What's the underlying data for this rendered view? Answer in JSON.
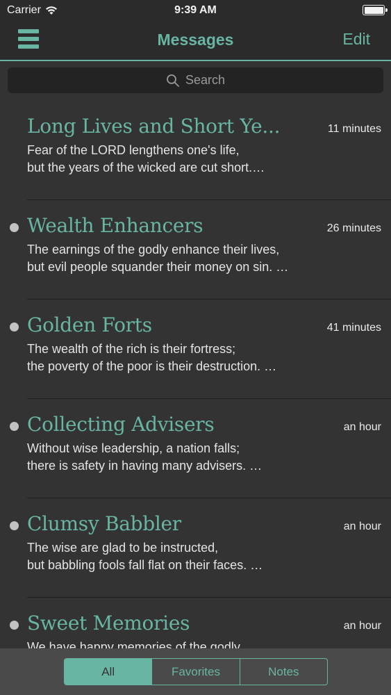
{
  "status_bar": {
    "carrier": "Carrier",
    "time": "9:39 AM"
  },
  "nav": {
    "title": "Messages",
    "edit_label": "Edit"
  },
  "search": {
    "placeholder": "Search"
  },
  "messages": [
    {
      "title": "Long Lives and Short Ye...",
      "time": "11 minutes",
      "unread": false,
      "line1": " Fear of the LORD lengthens one's life,",
      "line2": "but the years of the wicked are cut short.…"
    },
    {
      "title": "Wealth Enhancers",
      "time": "26 minutes",
      "unread": true,
      "line1": " The earnings of the godly enhance their lives,",
      "line2": "but evil people squander their money on sin. …"
    },
    {
      "title": "Golden Forts",
      "time": "41 minutes",
      "unread": true,
      "line1": " The wealth of the rich is their fortress;",
      "line2": "the poverty of the poor is their destruction. …"
    },
    {
      "title": "Collecting Advisers",
      "time": "an hour",
      "unread": true,
      "line1": " Without wise leadership, a nation falls;",
      "line2": "there is safety in having many advisers. …"
    },
    {
      "title": "Clumsy Babbler",
      "time": "an hour",
      "unread": true,
      "line1": " The wise are glad to be instructed,",
      "line2": "but babbling fools fall flat on their faces. …"
    },
    {
      "title": "Sweet Memories",
      "time": "an hour",
      "unread": true,
      "line1": " We have happy memories of the godly,",
      "line2": ""
    }
  ],
  "tabs": [
    {
      "label": "All",
      "active": true
    },
    {
      "label": "Favorites",
      "active": false
    },
    {
      "label": "Notes",
      "active": false
    }
  ],
  "colors": {
    "accent": "#69b5a3",
    "background": "#333334",
    "bar": "#2b2b2c"
  },
  "icons": {
    "menu": "hamburger-menu-icon",
    "search": "search-icon",
    "wifi": "wifi-icon",
    "battery": "battery-icon",
    "unread": "unread-dot-icon"
  }
}
